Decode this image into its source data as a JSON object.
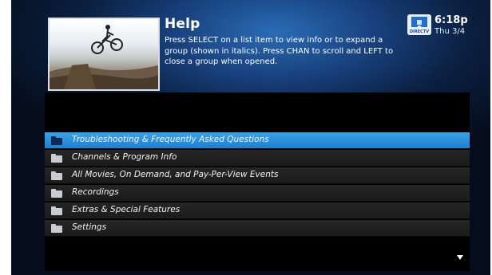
{
  "header": {
    "title": "Help",
    "description": "Press SELECT on a list item to view info or to expand a group (shown in italics). Press CHAN to scroll and LEFT to close a group when opened."
  },
  "logo": {
    "text": "DIRECTV"
  },
  "clock": {
    "time": "6:18p",
    "date": "Thu 3/4"
  },
  "menu": {
    "items": [
      {
        "label": "Troubleshooting & Frequently Asked Questions",
        "selected": true
      },
      {
        "label": "Channels & Program Info",
        "selected": false
      },
      {
        "label": "All Movies, On Demand, and Pay-Per-View Events",
        "selected": false
      },
      {
        "label": "Recordings",
        "selected": false
      },
      {
        "label": "Extras & Special Features",
        "selected": false
      },
      {
        "label": "Settings",
        "selected": false
      }
    ]
  },
  "colors": {
    "selected_row": "#2b8fdf",
    "background_blue": "#173f7a"
  },
  "icons": {
    "folder": "folder-icon",
    "scroll": "scroll-down-arrow-icon"
  }
}
